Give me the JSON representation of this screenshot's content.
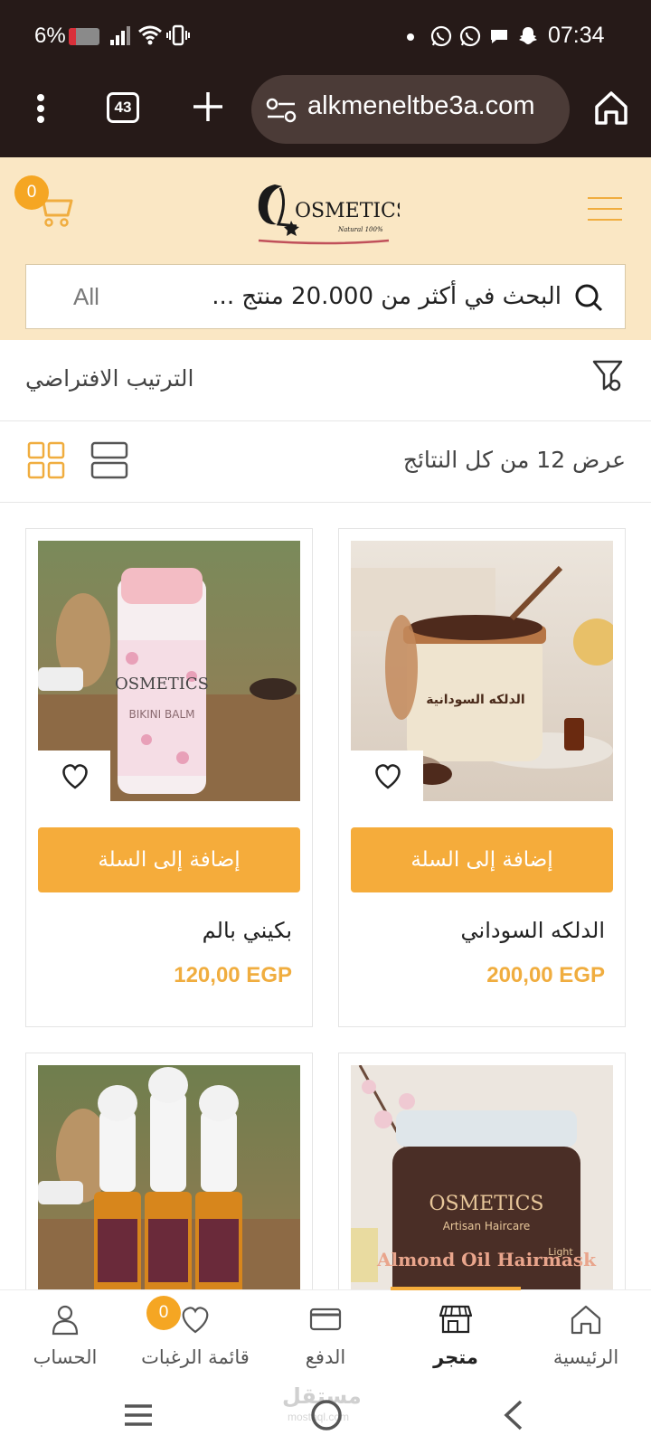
{
  "status_bar": {
    "battery_percent": "6%",
    "time": "07:34",
    "notification_icons": [
      "whatsapp-icon",
      "whatsapp-business-icon",
      "chat-icon",
      "snapchat-icon"
    ]
  },
  "browser": {
    "tab_count": "43",
    "url": "alkmeneltbe3a.com"
  },
  "header": {
    "cart_count": "0",
    "logo_text": "OSMETICS",
    "logo_tagline": "Natural 100%",
    "search_placeholder": "البحث في أكثر من 20.000 منتج ...",
    "search_category": "All"
  },
  "toolbar": {
    "sort_label": "الترتيب الافتراضي",
    "results_label": "عرض 12 من كل النتائج"
  },
  "products": [
    {
      "name": "الدلكه السوداني",
      "price": "200,00 EGP",
      "add_label": "إضافة إلى السلة"
    },
    {
      "name": "بكيني بالم",
      "price": "120,00 EGP",
      "add_label": "إضافة إلى السلة"
    },
    {
      "name": "",
      "price": "",
      "add_label": ""
    },
    {
      "name": "",
      "price": "",
      "add_label": ""
    }
  ],
  "product_images": {
    "dalka_jar_label": "الدلكه السودانية",
    "bikini_label": "BIKINI BALM",
    "almond_title": "Almond Oil Hairmask",
    "almond_sub": "Artisan Haircare",
    "almond_light": "Light"
  },
  "bottom_nav": {
    "home": "الرئيسية",
    "shop": "متجر",
    "checkout": "الدفع",
    "wishlist": "قائمة الرغبات",
    "wishlist_count": "0",
    "account": "الحساب"
  },
  "watermark": {
    "text": "مستقل",
    "sub": "mostaql.com"
  },
  "colors": {
    "accent": "#f5ac3b",
    "header_bg": "#fae7c4",
    "status_bg": "#261a18"
  }
}
